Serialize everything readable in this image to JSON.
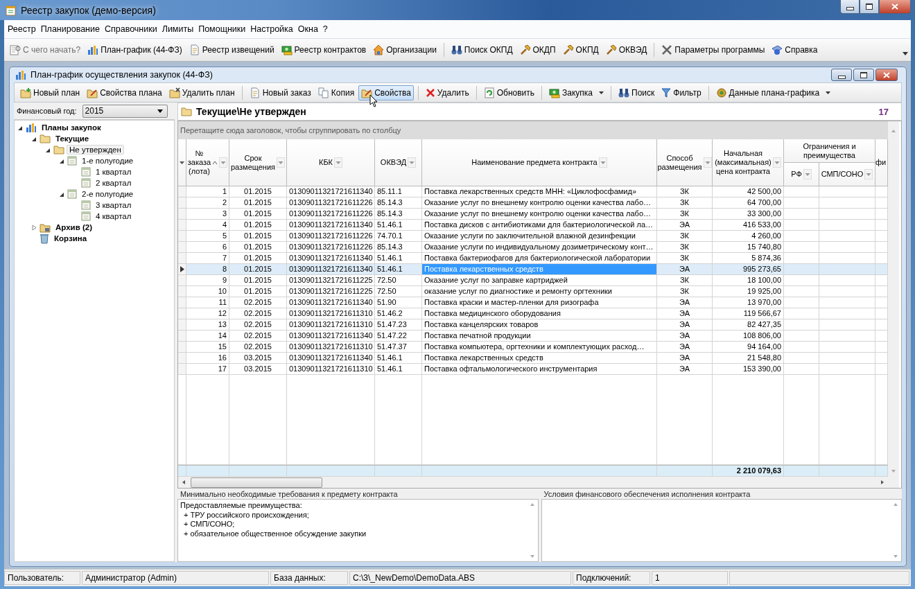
{
  "window": {
    "title": "Реестр закупок (демо-версия)"
  },
  "menu": [
    "Реестр",
    "Планирование",
    "Справочники",
    "Лимиты",
    "Помощники",
    "Настройка",
    "Окна",
    "?"
  ],
  "main_toolbar": [
    [
      {
        "label": "С чего начать?",
        "disabled": true
      },
      {
        "label": "План-график (44-ФЗ)",
        "disabled": false
      },
      {
        "label": "Реестр извещений",
        "disabled": false
      },
      {
        "label": "Реестр контрактов",
        "disabled": false
      },
      {
        "label": "Организации",
        "disabled": false
      }
    ],
    [
      {
        "label": "Поиск ОКПД",
        "disabled": false
      },
      {
        "label": "ОКДП",
        "disabled": false
      },
      {
        "label": "ОКПД",
        "disabled": false
      },
      {
        "label": "ОКВЭД",
        "disabled": false
      }
    ],
    [
      {
        "label": "Параметры программы",
        "disabled": false
      },
      {
        "label": "Справка",
        "disabled": false
      }
    ]
  ],
  "child_window": {
    "title": "План-график осуществления закупок (44-ФЗ)",
    "toolbar": [
      [
        {
          "label": "Новый план",
          "selected": false,
          "dropdown": false
        },
        {
          "label": "Свойства плана",
          "selected": false,
          "dropdown": false
        },
        {
          "label": "Удалить план",
          "selected": false,
          "dropdown": false
        }
      ],
      [
        {
          "label": "Новый заказ",
          "selected": false,
          "dropdown": false
        },
        {
          "label": "Копия",
          "selected": false,
          "dropdown": false
        },
        {
          "label": "Свойства",
          "selected": true,
          "dropdown": false
        }
      ],
      [
        {
          "label": "Удалить",
          "selected": false,
          "dropdown": false
        }
      ],
      [
        {
          "label": "Обновить",
          "selected": false,
          "dropdown": false
        }
      ],
      [
        {
          "label": "Закупка",
          "selected": false,
          "dropdown": true
        }
      ],
      [
        {
          "label": "Поиск",
          "selected": false,
          "dropdown": false
        },
        {
          "label": "Фильтр",
          "selected": false,
          "dropdown": false
        }
      ],
      [
        {
          "label": "Данные плана-графика",
          "selected": false,
          "dropdown": true
        }
      ]
    ],
    "year_filter": {
      "label": "Финансовый год:",
      "value": "2015"
    },
    "tree": [
      {
        "label": "Планы закупок",
        "kind": "root",
        "selected": false,
        "expanded": true,
        "children": [
          {
            "label": "Текущие",
            "kind": "folder",
            "selected": false,
            "expanded": true,
            "children": [
              {
                "label": "Не утвержден",
                "kind": "folder",
                "selected": true,
                "expanded": true,
                "children": [
                  {
                    "label": "1-е полугодие",
                    "kind": "period",
                    "selected": false,
                    "expanded": true,
                    "children": [
                      {
                        "label": "1 квартал",
                        "kind": "quarter",
                        "selected": false
                      },
                      {
                        "label": "2 квартал",
                        "kind": "quarter",
                        "selected": false
                      }
                    ]
                  },
                  {
                    "label": "2-е полугодие",
                    "kind": "period",
                    "selected": false,
                    "expanded": true,
                    "children": [
                      {
                        "label": "3 квартал",
                        "kind": "quarter",
                        "selected": false
                      },
                      {
                        "label": "4 квартал",
                        "kind": "quarter",
                        "selected": false
                      }
                    ]
                  }
                ]
              }
            ]
          },
          {
            "label": "Архив (2)",
            "kind": "archive",
            "selected": false,
            "expanded": false
          },
          {
            "label": "Корзина",
            "kind": "trash",
            "selected": false
          }
        ]
      }
    ],
    "path": "Текущие\\Не утвержден",
    "count": "17",
    "group_hint": "Перетащите сюда заголовок, чтобы сгруппировать по столбцу",
    "table": {
      "columns": [
        {
          "label": "№\nзаказа\n(лота)",
          "sorted": true,
          "filter": true
        },
        {
          "label": "Срок\nразмещения",
          "sorted": false,
          "filter": true
        },
        {
          "label": "КБК",
          "sorted": false,
          "filter": true
        },
        {
          "label": "ОКВЭД",
          "sorted": false,
          "filter": true
        },
        {
          "label": "Наименование предмета контракта",
          "sorted": false,
          "filter": true
        },
        {
          "label": "Способ\nразмещения",
          "sorted": false,
          "filter": true
        },
        {
          "label": "Начальная\n(максимальная)\nцена контракта",
          "sorted": false,
          "filter": true
        }
      ],
      "column_group": {
        "label": "Ограничения и\nпреимущества",
        "columns": [
          {
            "label": "РФ",
            "filter": true
          },
          {
            "label": "СМП/СОНО",
            "filter": true
          }
        ]
      },
      "column_11": {
        "label": "фи"
      },
      "rows": [
        {
          "n": "1",
          "date": "01.2015",
          "kbk": "01309011321721611340",
          "okved": "85.11.1",
          "name": "Поставка лекарственных средств МНН: «Циклофосфамид»",
          "method": "ЗК",
          "price": "42 500,00",
          "selected": false
        },
        {
          "n": "2",
          "date": "01.2015",
          "kbk": "01309011321721611226",
          "okved": "85.14.3",
          "name": "Оказание услуг по внешнему контролю оценки качества лабо…",
          "method": "ЗК",
          "price": "64 700,00",
          "selected": false
        },
        {
          "n": "3",
          "date": "01.2015",
          "kbk": "01309011321721611226",
          "okved": "85.14.3",
          "name": "Оказание услуг по внешнему контролю оценки качества лабо…",
          "method": "ЗК",
          "price": "33 300,00",
          "selected": false
        },
        {
          "n": "4",
          "date": "01.2015",
          "kbk": "01309011321721611340",
          "okved": "51.46.1",
          "name": "Поставка дисков с антибиотиками для бактериологической ла…",
          "method": "ЭА",
          "price": "416 533,00",
          "selected": false
        },
        {
          "n": "5",
          "date": "01.2015",
          "kbk": "01309011321721611226",
          "okved": "74.70.1",
          "name": "Оказание услуги по заключительной влажной дезинфекции",
          "method": "ЗК",
          "price": "4 260,00",
          "selected": false
        },
        {
          "n": "6",
          "date": "01.2015",
          "kbk": "01309011321721611226",
          "okved": "85.14.3",
          "name": "Оказание услуги по индивидуальному дозиметрическому конт…",
          "method": "ЗК",
          "price": "15 740,80",
          "selected": false
        },
        {
          "n": "7",
          "date": "01.2015",
          "kbk": "01309011321721611340",
          "okved": "51.46.1",
          "name": "Поставка бактериофагов для бактериологической лаборатории",
          "method": "ЗК",
          "price": "5 874,36",
          "selected": false
        },
        {
          "n": "8",
          "date": "01.2015",
          "kbk": "01309011321721611340",
          "okved": "51.46.1",
          "name": "Поставка лекарственных средств",
          "method": "ЭА",
          "price": "995 273,65",
          "selected": true
        },
        {
          "n": "9",
          "date": "01.2015",
          "kbk": "01309011321721611225",
          "okved": "72.50",
          "name": "Оказание услуг по заправке картриджей",
          "method": "ЗК",
          "price": "18 100,00",
          "selected": false
        },
        {
          "n": "10",
          "date": "01.2015",
          "kbk": "01309011321721611225",
          "okved": "72.50",
          "name": "оказание услуг по диагностике и ремонту оргтехники",
          "method": "ЗК",
          "price": "19 925,00",
          "selected": false
        },
        {
          "n": "11",
          "date": "02.2015",
          "kbk": "01309011321721611340",
          "okved": "51.90",
          "name": "Поставка краски и мастер-пленки для ризографа",
          "method": "ЭА",
          "price": "13 970,00",
          "selected": false
        },
        {
          "n": "12",
          "date": "02.2015",
          "kbk": "01309011321721611310",
          "okved": "51.46.2",
          "name": "Поставка медицинского оборудования",
          "method": "ЭА",
          "price": "119 566,67",
          "selected": false
        },
        {
          "n": "13",
          "date": "02.2015",
          "kbk": "01309011321721611310",
          "okved": "51.47.23",
          "name": "Поставка канцелярских товаров",
          "method": "ЭА",
          "price": "82 427,35",
          "selected": false
        },
        {
          "n": "14",
          "date": "02.2015",
          "kbk": "01309011321721611340",
          "okved": "51.47.22",
          "name": "Поставка печатной продукции",
          "method": "ЭА",
          "price": "108 806,00",
          "selected": false
        },
        {
          "n": "15",
          "date": "02.2015",
          "kbk": "01309011321721611310",
          "okved": "51.47.37",
          "name": "Поставка компьютера, оргтехники и комплектующих  расход…",
          "method": "ЭА",
          "price": "94 164,00",
          "selected": false
        },
        {
          "n": "16",
          "date": "03.2015",
          "kbk": "01309011321721611340",
          "okved": "51.46.1",
          "name": "Поставка лекарственных средств",
          "method": "ЭА",
          "price": "21 548,80",
          "selected": false
        },
        {
          "n": "17",
          "date": "03.2015",
          "kbk": "01309011321721611310",
          "okved": "51.46.1",
          "name": "Поставка офтальмологического инструментария",
          "method": "ЭА",
          "price": "153 390,00",
          "selected": false
        }
      ],
      "total": "2 210 079,63"
    },
    "requirements_panel": {
      "title": "Минимально необходимые требования  к предмету контракта",
      "lines": [
        "Предоставляемые преимущества:",
        "+ ТРУ российского происхождения;",
        "+ СМП/СОНО;",
        "+ обязательное общественное обсуждение закупки"
      ]
    },
    "security_panel": {
      "title": "Условия финансового обеспечения исполнения контракта"
    }
  },
  "status_bar": [
    {
      "label": "Пользователь:",
      "value": "Администратор (Admin)"
    },
    {
      "label": "База данных:",
      "value": "C:\\3\\_NewDemo\\DemoData.ABS"
    },
    {
      "label": "Подключений:",
      "value": "1"
    }
  ]
}
